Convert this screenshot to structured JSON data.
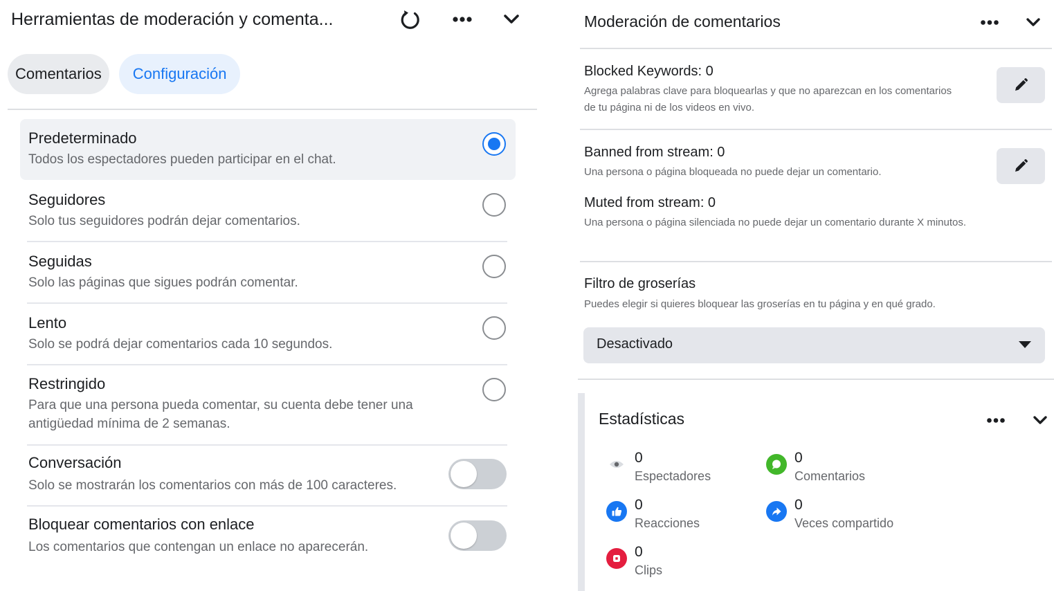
{
  "left": {
    "title": "Herramientas de moderación y comenta...",
    "tabs": [
      {
        "label": "Comentarios"
      },
      {
        "label": "Configuración"
      }
    ],
    "options": [
      {
        "label": "Predeterminado",
        "desc": "Todos los espectadores pueden participar en el chat.",
        "control": "radio",
        "selected": true
      },
      {
        "label": "Seguidores",
        "desc": "Solo tus seguidores podrán dejar comentarios.",
        "control": "radio",
        "selected": false
      },
      {
        "label": "Seguidas",
        "desc": "Solo las páginas que sigues podrán comentar.",
        "control": "radio",
        "selected": false
      },
      {
        "label": "Lento",
        "desc": "Solo se podrá dejar comentarios cada 10 segundos.",
        "control": "radio",
        "selected": false
      },
      {
        "label": "Restringido",
        "desc": "Para que una persona pueda comentar, su cuenta debe tener una antigüedad mínima de 2 semanas.",
        "control": "radio",
        "selected": false
      },
      {
        "label": "Conversación",
        "desc": "Solo se mostrarán los comentarios con más de 100 caracteres.",
        "control": "toggle",
        "on": false
      },
      {
        "label": "Bloquear comentarios con enlace",
        "desc": "Los comentarios que contengan un enlace no aparecerán.",
        "control": "toggle",
        "on": false
      }
    ],
    "icons": {
      "refresh": "refresh-icon",
      "more": "more-icon",
      "collapse": "chevron-down-icon"
    }
  },
  "right": {
    "title": "Moderación de comentarios",
    "blocked_keywords": {
      "title": "Blocked Keywords: 0",
      "desc": "Agrega palabras clave para bloquearlas y que no aparezcan en los comentarios de tu página ni de los videos en vivo."
    },
    "banned": {
      "title": "Banned from stream: 0",
      "desc": "Una persona o página bloqueada no puede dejar un comentario."
    },
    "muted": {
      "title": "Muted from stream: 0",
      "desc": "Una persona o página silenciada no puede dejar un comentario durante X minutos."
    },
    "profanity": {
      "title": "Filtro de groserías",
      "desc": "Puedes elegir si quieres bloquear las groserías en tu página y en qué grado.",
      "selected": "Desactivado"
    },
    "stats": {
      "title": "Estadísticas",
      "items": [
        {
          "value": "0",
          "label": "Espectadores",
          "icon": "eye-icon",
          "color": "#e4e6eb"
        },
        {
          "value": "0",
          "label": "Comentarios",
          "icon": "comment-icon",
          "color": "#42b72a"
        },
        {
          "value": "0",
          "label": "Reacciones",
          "icon": "like-icon",
          "color": "#1877f2"
        },
        {
          "value": "0",
          "label": "Veces compartido",
          "icon": "share-icon",
          "color": "#1877f2"
        },
        {
          "value": "0",
          "label": "Clips",
          "icon": "clip-icon",
          "color": "#e41e3f"
        }
      ]
    }
  },
  "colors": {
    "accent": "#1877f2",
    "text": "#1c1e21",
    "muted": "#65676b",
    "control_bg": "#e4e6eb"
  }
}
